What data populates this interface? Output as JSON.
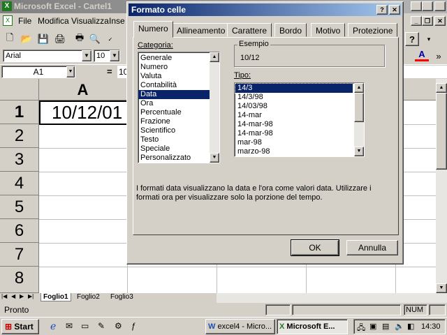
{
  "window": {
    "title": "Microsoft Excel - Cartel1"
  },
  "menu": {
    "items": [
      "File",
      "Modifica",
      "Visualizza",
      "Inse"
    ]
  },
  "toolbar": {
    "font": "Arial",
    "size": "10"
  },
  "formula": {
    "namebox": "A1",
    "eq": "=",
    "content": "10"
  },
  "sheet": {
    "col_a": "A",
    "rows": [
      "1",
      "2",
      "3",
      "4",
      "5",
      "6",
      "7",
      "8"
    ],
    "a1_value": "10/12/01",
    "tabs": [
      "Foglio1",
      "Foglio2",
      "Foglio3"
    ]
  },
  "status": {
    "text": "Pronto",
    "num": "NUM"
  },
  "taskbar": {
    "start": "Start",
    "task1": "excel4 - Micro...",
    "task2": "Microsoft E...",
    "clock": "14:30"
  },
  "dialog": {
    "title": "Formato celle",
    "help": "?",
    "close": "✕",
    "tabs": [
      "Numero",
      "Allineamento",
      "Carattere",
      "Bordo",
      "Motivo",
      "Protezione"
    ],
    "category_label": "Categoria:",
    "categories": [
      "Generale",
      "Numero",
      "Valuta",
      "Contabilità",
      "Data",
      "Ora",
      "Percentuale",
      "Frazione",
      "Scientifico",
      "Testo",
      "Speciale",
      "Personalizzato"
    ],
    "selected_category": "Data",
    "sample_label": "Esempio",
    "sample_value": "10/12",
    "type_label": "Tipo:",
    "types": [
      "14/3",
      "14/3/98",
      "14/03/98",
      "14-mar",
      "14-mar-98",
      "14-mar-98",
      "mar-98",
      "marzo-98"
    ],
    "selected_type": "14/3",
    "description": "I formati data visualizzano la data e l'ora come valori data. Utilizzare i formati ora per visualizzare solo la porzione del tempo.",
    "ok": "OK",
    "cancel": "Annulla"
  },
  "colors": {
    "dialog_title": "#0a246a",
    "selection": "#0a246a",
    "face": "#d4d0c8"
  }
}
